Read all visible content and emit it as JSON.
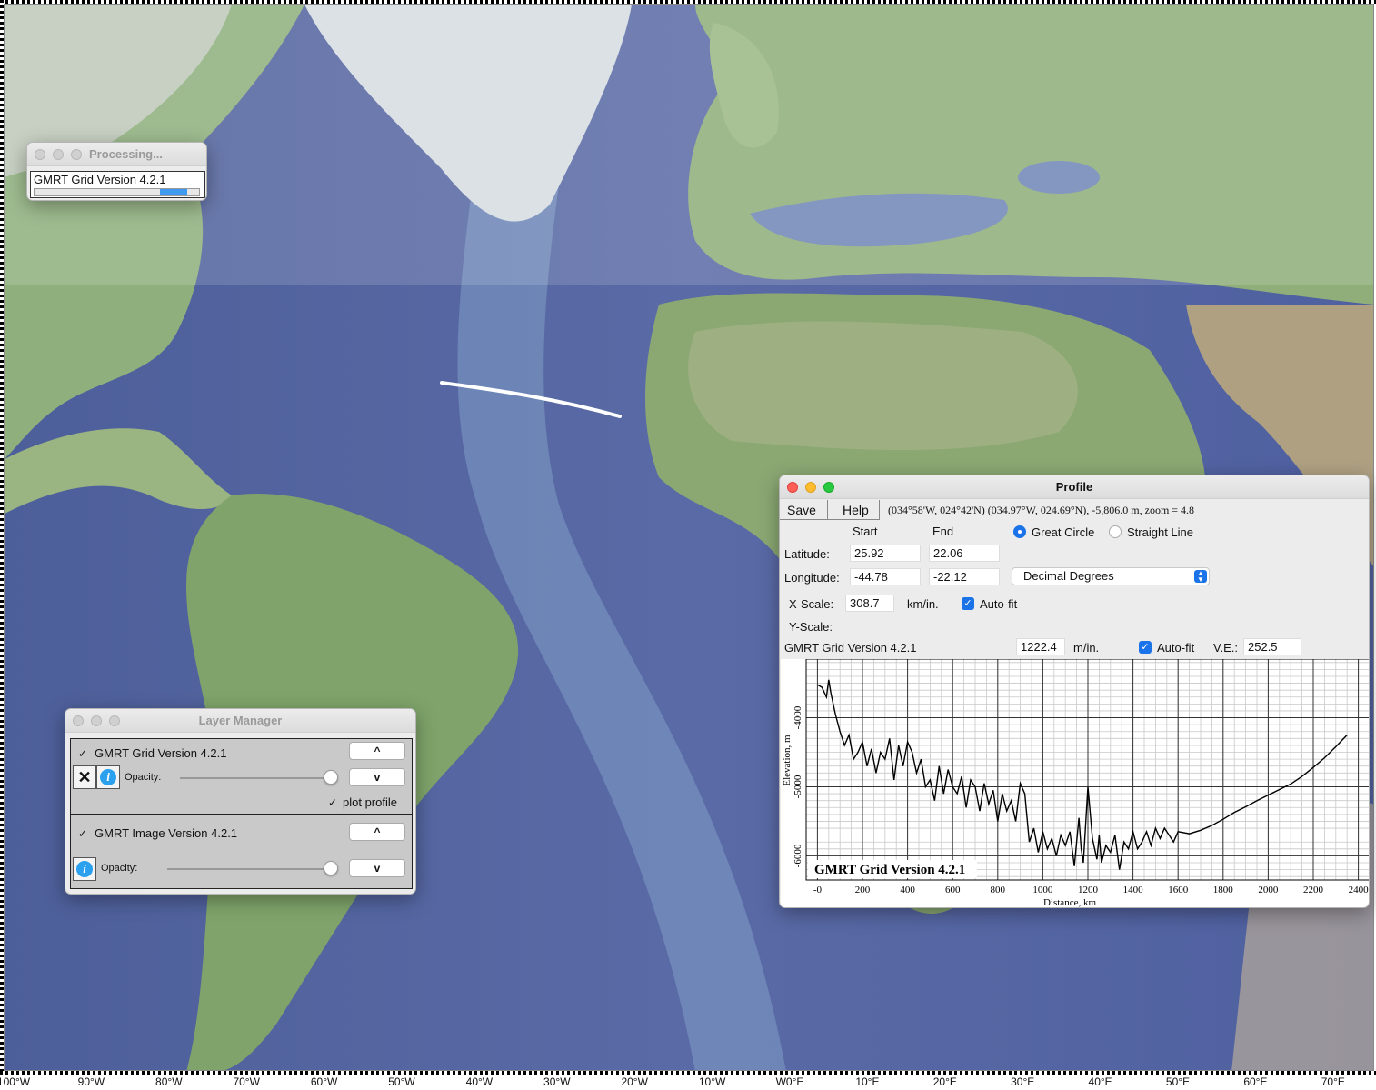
{
  "map": {
    "lon_labels": [
      "100°W",
      "90°W",
      "80°W",
      "70°W",
      "60°W",
      "50°W",
      "40°W",
      "30°W",
      "20°W",
      "10°W",
      "W0°E",
      "10°E",
      "20°E",
      "30°E",
      "40°E",
      "50°E",
      "60°E",
      "70°E"
    ],
    "profile_line": {
      "start": {
        "lat": 25.92,
        "lon": -44.78
      },
      "end": {
        "lat": 22.06,
        "lon": -22.12
      }
    }
  },
  "processing": {
    "title": "Processing...",
    "label": "GMRT Grid Version 4.2.1",
    "progress_start": 0.76,
    "progress_end": 0.93
  },
  "layer_manager": {
    "title": "Layer Manager",
    "layers": [
      {
        "name": "GMRT Grid Version 4.2.1",
        "checked": "✓",
        "opacity_label": "Opacity:",
        "opacity": 1.0,
        "plot_profile_label": "plot profile",
        "plot_profile_checked": "✓",
        "up": "^",
        "down": "v",
        "remove_icon": "✕",
        "info_icon": "i"
      },
      {
        "name": "GMRT Image Version 4.2.1",
        "checked": "✓",
        "opacity_label": "Opacity:",
        "opacity": 1.0,
        "up": "^",
        "down": "v",
        "info_icon": "i"
      }
    ]
  },
  "profile": {
    "title": "Profile",
    "menu": {
      "save": "Save",
      "help": "Help"
    },
    "readout": "(034°58'W, 024°42'N) (034.97°W, 024.69°N), -5,806.0 m, zoom = 4.8",
    "start_label": "Start",
    "end_label": "End",
    "mode_great": "Great Circle",
    "mode_straight": "Straight Line",
    "lat_label": "Latitude:",
    "lon_label": "Longitude:",
    "lat_start": "25.92",
    "lat_end": "22.06",
    "lon_start": "-44.78",
    "lon_end": "-22.12",
    "units": "Decimal Degrees",
    "xscale_label": "X-Scale:",
    "xscale": "308.7",
    "xscale_unit": "km/in.",
    "autofit": "Auto-fit",
    "yscale_label": "Y-Scale:",
    "grid_name": "GMRT Grid Version 4.2.1",
    "yscale": "1222.4",
    "yscale_unit": "m/in.",
    "ve_label": "V.E.:",
    "ve": "252.5"
  },
  "chart_data": {
    "type": "line",
    "title": "GMRT Grid Version 4.2.1",
    "xlabel": "Distance, km",
    "ylabel": "Elevation, m",
    "xlim": [
      -50,
      2450
    ],
    "ylim": [
      -6350,
      -3150
    ],
    "x_ticks": [
      0,
      200,
      400,
      600,
      800,
      1000,
      1200,
      1400,
      1600,
      1800,
      2000,
      2200,
      2400
    ],
    "x_tick_labels": [
      "-0",
      "200",
      "400",
      "600",
      "800",
      "1000",
      "1200",
      "1400",
      "1600",
      "1800",
      "2000",
      "2200",
      "2400"
    ],
    "y_ticks": [
      -4000,
      -5000,
      -6000
    ],
    "y_tick_labels": [
      "-4000",
      "-5000",
      "-6000"
    ],
    "series": [
      {
        "x": [
          0,
          20,
          40,
          50,
          60,
          80,
          100,
          120,
          140,
          160,
          180,
          200,
          220,
          240,
          260,
          280,
          300,
          320,
          340,
          360,
          380,
          400,
          420,
          440,
          460,
          480,
          500,
          520,
          540,
          560,
          580,
          600,
          620,
          640,
          660,
          680,
          700,
          720,
          740,
          760,
          780,
          800,
          820,
          840,
          860,
          880,
          900,
          920,
          940,
          960,
          980,
          1000,
          1020,
          1040,
          1060,
          1080,
          1100,
          1120,
          1140,
          1160,
          1170,
          1180,
          1200,
          1220,
          1240,
          1250,
          1260,
          1280,
          1300,
          1320,
          1340,
          1360,
          1380,
          1400,
          1420,
          1440,
          1460,
          1480,
          1500,
          1520,
          1540,
          1560,
          1580,
          1600,
          1650,
          1700,
          1750,
          1800,
          1850,
          1900,
          1950,
          2000,
          2050,
          2100,
          2150,
          2200,
          2250,
          2300,
          2350
        ],
        "y": [
          -3520,
          -3560,
          -3700,
          -3450,
          -3650,
          -3950,
          -4200,
          -4400,
          -4250,
          -4600,
          -4500,
          -4350,
          -4700,
          -4450,
          -4800,
          -4500,
          -4600,
          -4300,
          -4900,
          -4400,
          -4700,
          -4350,
          -4500,
          -4800,
          -4600,
          -5000,
          -4900,
          -5200,
          -4700,
          -5100,
          -4750,
          -5000,
          -5100,
          -4850,
          -5300,
          -4900,
          -5000,
          -5350,
          -4950,
          -5250,
          -5050,
          -5500,
          -5100,
          -5350,
          -5200,
          -5500,
          -4950,
          -5100,
          -5800,
          -5600,
          -5950,
          -5650,
          -5900,
          -5750,
          -6000,
          -5700,
          -5850,
          -5650,
          -6150,
          -5450,
          -5900,
          -6100,
          -5000,
          -5750,
          -6050,
          -5700,
          -6100,
          -5850,
          -5950,
          -5700,
          -6200,
          -5800,
          -5900,
          -5650,
          -5900,
          -5800,
          -5650,
          -5850,
          -5600,
          -5750,
          -5600,
          -5700,
          -5800,
          -5650,
          -5680,
          -5630,
          -5560,
          -5470,
          -5370,
          -5290,
          -5200,
          -5120,
          -5040,
          -4960,
          -4850,
          -4720,
          -4580,
          -4420,
          -4250
        ]
      }
    ]
  }
}
